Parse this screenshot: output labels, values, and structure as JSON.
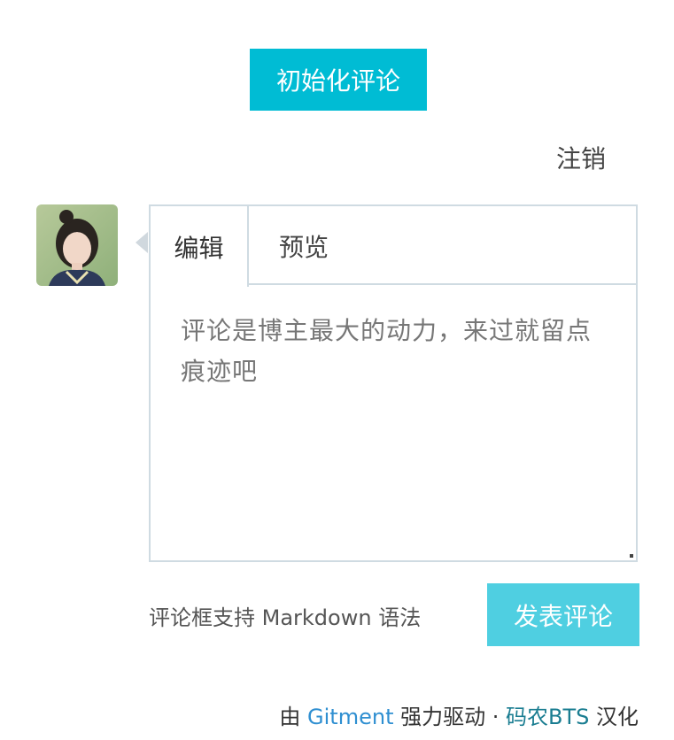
{
  "init_button": {
    "label": "初始化评论"
  },
  "logout": {
    "label": "注销"
  },
  "avatar": {
    "icon": "user-avatar"
  },
  "editor": {
    "tabs": [
      {
        "label": "编辑",
        "active": true
      },
      {
        "label": "预览",
        "active": false
      }
    ],
    "placeholder": "评论是博主最大的动力，来过就留点痕迹吧"
  },
  "markdown_tip": "评论框支持 Markdown 语法",
  "submit_button": {
    "label": "发表评论"
  },
  "footer": {
    "prefix": "由 ",
    "gitment_link": "Gitment",
    "middle": " 强力驱动 · ",
    "translator_link": "码农BTS",
    "suffix": " 汉化"
  },
  "colors": {
    "accent": "#00bcd4",
    "submit_bg": "#4fcfe1",
    "border": "#cfdbe2",
    "link": "#2f8fd1"
  }
}
